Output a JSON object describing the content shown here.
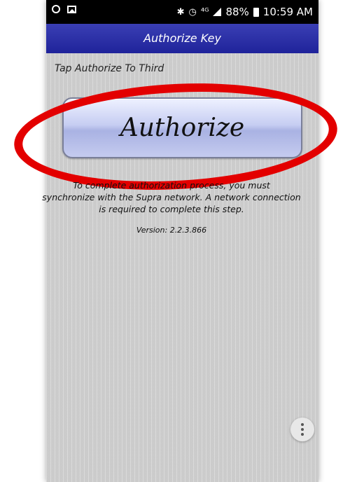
{
  "status_bar": {
    "battery": "88%",
    "time": "10:59 AM",
    "icons": [
      "circle-icon",
      "image-icon",
      "bluetooth-icon",
      "alarm-icon",
      "4g-icon",
      "signal-icon",
      "battery-icon"
    ]
  },
  "header": {
    "title": "Authorize Key"
  },
  "main": {
    "hint": "Tap Authorize To Third",
    "authorize_label": "Authorize",
    "description_line1": "To complete authorization process, you must",
    "description_line2": "synchronize with the Supra network. A network connection",
    "description_line3": "is required to complete this step.",
    "version": "Version: 2.2.3.866"
  },
  "colors": {
    "title_bar": "#1f239a",
    "annotation": "#e30000",
    "background": "#d2d2d2"
  }
}
